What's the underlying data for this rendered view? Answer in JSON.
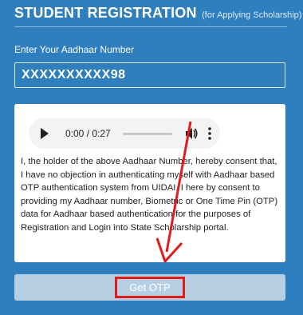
{
  "header": {
    "title": "STUDENT REGISTRATION",
    "subtitle": "(for Applying Scholarship)"
  },
  "aadhaar": {
    "label": "Enter Your Aadhaar Number",
    "value": "XXXXXXXXXX98"
  },
  "audio": {
    "current_time": "0:00",
    "separator": " / ",
    "duration": "0:27",
    "progress": 0
  },
  "consent": {
    "text": "I, the holder of the above Aadhaar Number, hereby consent that, I have no objection in authenticating myself with Aadhaar based OTP authentication system from UIDAI. I here by consent to providing my Aadhaar number, Biometric or One Time Pin (OTP) data for Aadhaar based authentication for the purposes of Registration and Login into State Scholarship portal."
  },
  "button": {
    "get_otp": "Get OTP"
  },
  "colors": {
    "page_bg": "#2f7fbf",
    "annotation_red": "#e21b1b",
    "button_bar": "#b6cfe3"
  }
}
